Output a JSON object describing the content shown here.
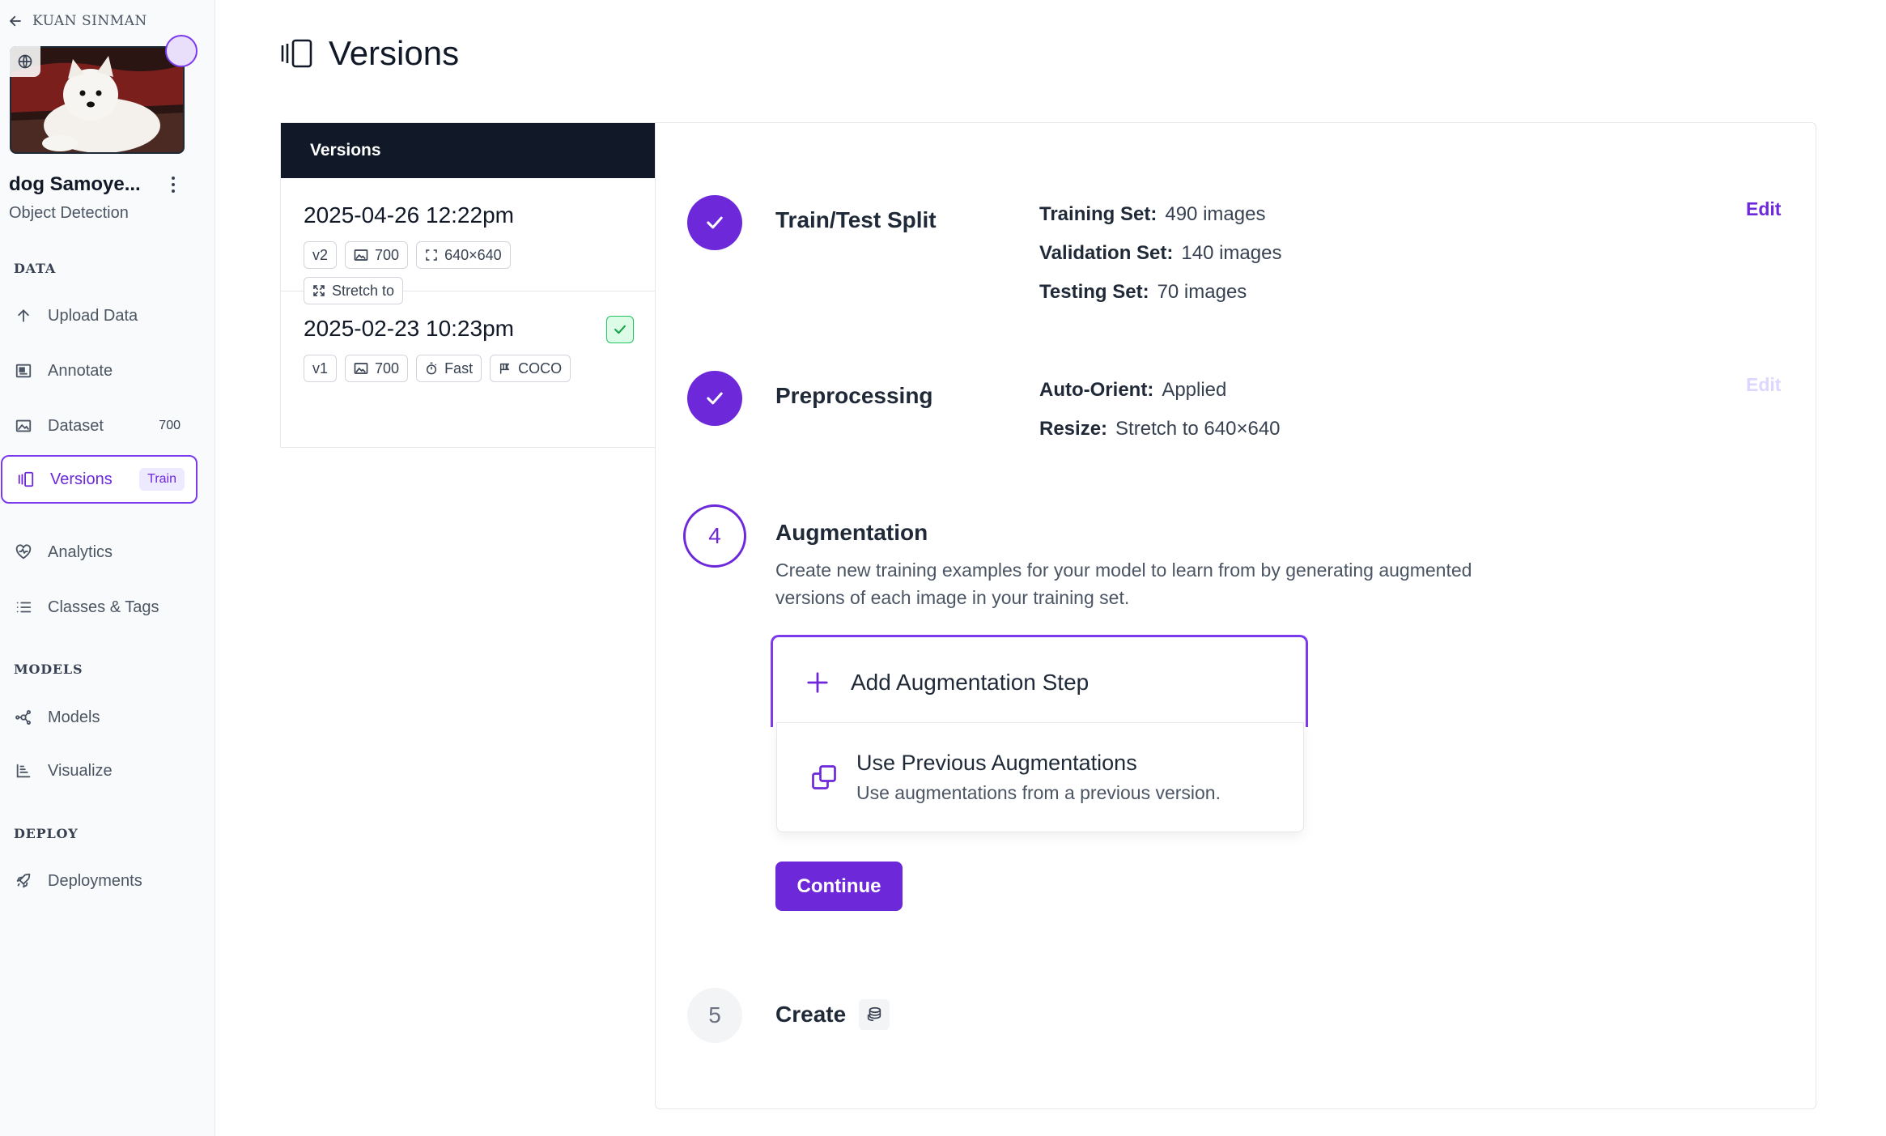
{
  "sidebar": {
    "workspace": "KUAN SINMAN",
    "project": {
      "name": "dog Samoye...",
      "type": "Object Detection"
    },
    "sections": {
      "data": "DATA",
      "models": "MODELS",
      "deploy": "DEPLOY"
    },
    "items": {
      "upload": "Upload Data",
      "annotate": "Annotate",
      "dataset": "Dataset",
      "dataset_count": "700",
      "versions": "Versions",
      "versions_badge": "Train",
      "analytics": "Analytics",
      "classes": "Classes & Tags",
      "models": "Models",
      "visualize": "Visualize",
      "deployments": "Deployments"
    }
  },
  "page": {
    "title": "Versions"
  },
  "versions_panel": {
    "header": "Versions",
    "items": [
      {
        "date": "2025-04-26 12:22pm",
        "version": "v2",
        "images": "700",
        "size": "640×640",
        "resize": "Stretch to"
      },
      {
        "date": "2025-02-23 10:23pm",
        "version": "v1",
        "images": "700",
        "speed": "Fast",
        "format": "COCO"
      }
    ]
  },
  "steps": {
    "split": {
      "title": "Train/Test Split",
      "training_label": "Training Set:",
      "training_value": "490 images",
      "validation_label": "Validation Set:",
      "validation_value": "140 images",
      "testing_label": "Testing Set:",
      "testing_value": "70 images",
      "edit": "Edit"
    },
    "preprocessing": {
      "title": "Preprocessing",
      "orient_label": "Auto-Orient:",
      "orient_value": "Applied",
      "resize_label": "Resize:",
      "resize_value": "Stretch to 640×640",
      "edit": "Edit"
    },
    "augmentation": {
      "number": "4",
      "title": "Augmentation",
      "description": "Create new training examples for your model to learn from by generating augmented versions of each image in your training set.",
      "add_step": "Add Augmentation Step",
      "use_previous_title": "Use Previous Augmentations",
      "use_previous_desc": "Use augmentations from a previous version.",
      "continue": "Continue"
    },
    "create": {
      "number": "5",
      "title": "Create"
    }
  },
  "colors": {
    "accent": "#6d28d9",
    "header_dark": "#111827",
    "success": "#22c55e"
  }
}
